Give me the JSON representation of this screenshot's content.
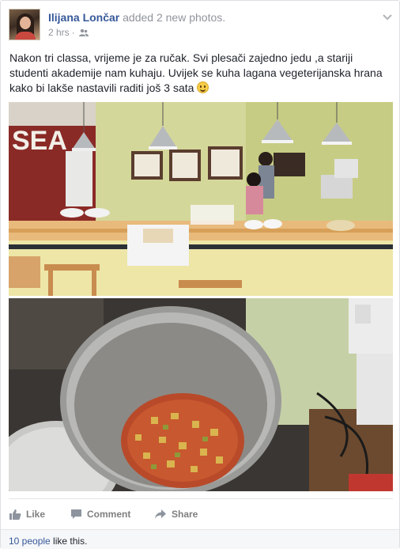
{
  "post": {
    "author": "Ilijana Lončar",
    "action": "added 2 new photos.",
    "time": "2 hrs",
    "privacy_icon": "friends-icon",
    "menu_icon": "chevron-down-icon",
    "text": "Nakon tri classa, vrijeme je za ručak. Svi plesači zajedno jedu ,a stariji studenti akademije nam kuhaju. Uvijek se kuha lagana vegeterijanska hrana kako bi lakše nastavili raditi još 3 sata",
    "emoji": "smile-emoji"
  },
  "photos": [
    {
      "name": "kitchen-photo",
      "wall_sign": "SEA"
    },
    {
      "name": "cooking-pot-photo"
    }
  ],
  "actions": {
    "like": "Like",
    "comment": "Comment",
    "share": "Share"
  },
  "likes": {
    "count_text": "10 people",
    "suffix": " like this."
  },
  "colors": {
    "link": "#365899",
    "muted": "#90949c",
    "action_gray": "#7f7f7f",
    "footer_bg": "#f6f7f9"
  }
}
